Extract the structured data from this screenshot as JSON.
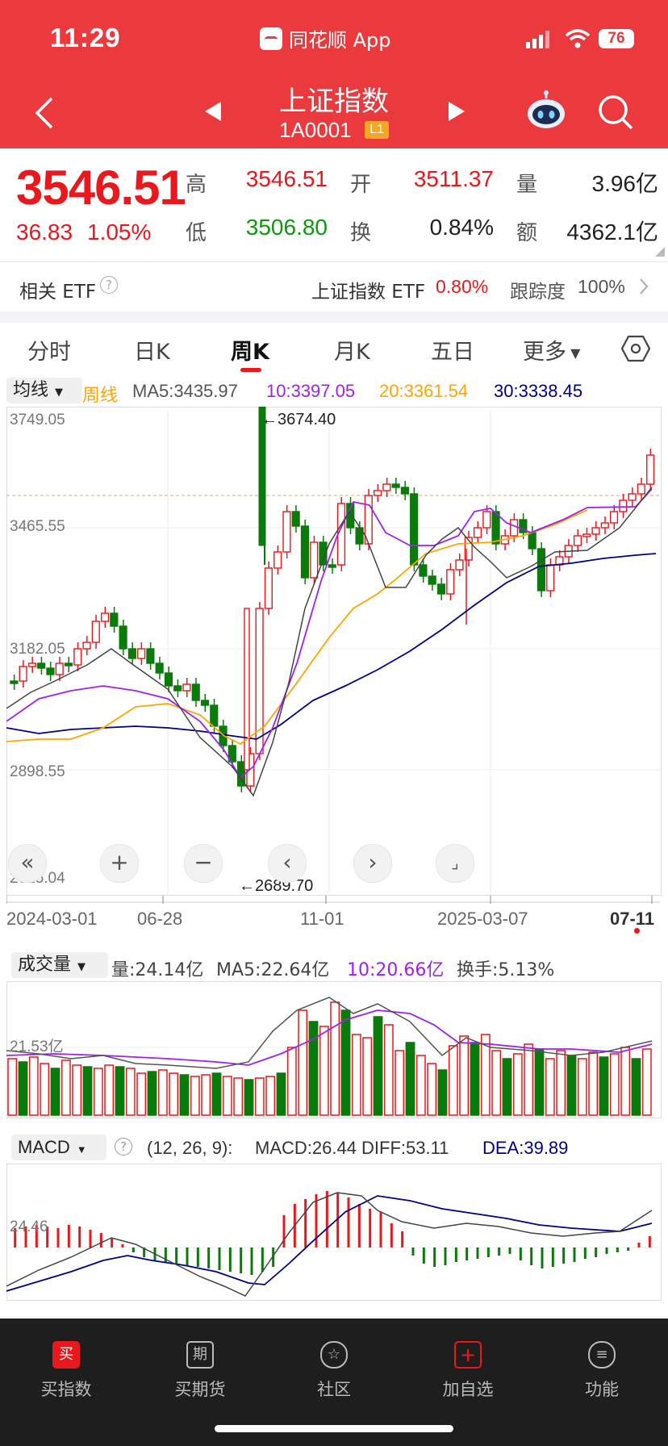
{
  "status_bar": {
    "time": "11:29",
    "app_name": "同花顺 App",
    "battery": "76"
  },
  "nav": {
    "title": "上证指数",
    "code": "1A0001",
    "badge": "L1"
  },
  "quote": {
    "price": "3546.51",
    "change": "36.83",
    "change_pct": "1.05%",
    "high_label": "高",
    "high": "3546.51",
    "low_label": "低",
    "low": "3506.80",
    "open_label": "开",
    "open": "3511.37",
    "turnover_label": "换",
    "turnover": "0.84%",
    "volume_label": "量",
    "volume": "3.96亿",
    "amount_label": "额",
    "amount": "4362.1亿"
  },
  "etf": {
    "label": "相关 ETF",
    "name": "上证指数 ETF",
    "change": "0.80%",
    "track_label": "跟踪度",
    "track": "100%"
  },
  "tabs": [
    {
      "label": "分时"
    },
    {
      "label": "日K"
    },
    {
      "label": "周K",
      "active": true
    },
    {
      "label": "月K"
    },
    {
      "label": "五日"
    },
    {
      "label": "更多"
    }
  ],
  "ma_bar": {
    "selector": "均线",
    "period": "周线",
    "ma5": "MA5:3435.97",
    "ma10": "10:3397.05",
    "ma20": "20:3361.54",
    "ma30": "30:3338.45"
  },
  "kline": {
    "y_labels": [
      "3749.05",
      "3465.55",
      "3182.05",
      "2898.55",
      "2615.04"
    ],
    "max_annot": "←3674.40",
    "min_annot": "←2689.70",
    "dates": [
      "2024-03-01",
      "06-28",
      "11-01",
      "2025-03-07",
      "07-11"
    ]
  },
  "volume": {
    "selector": "成交量",
    "vol": "量:24.14亿",
    "ma5": "MA5:22.64亿",
    "ma10": "10:20.66亿",
    "turnover": "换手:5.13%",
    "y_label": "21.53亿"
  },
  "macd": {
    "selector": "MACD",
    "params": "(12, 26, 9):",
    "macd": "MACD:26.44",
    "diff": "DIFF:53.11",
    "dea": "DEA:39.89",
    "y_label": "24.46"
  },
  "bottom_nav": [
    {
      "label": "买指数",
      "icon": "买"
    },
    {
      "label": "买期货",
      "icon": "期"
    },
    {
      "label": "社区",
      "icon": "☆"
    },
    {
      "label": "加自选",
      "icon": "+"
    },
    {
      "label": "功能",
      "icon": "≡"
    }
  ],
  "colors": {
    "up": "#e8181d",
    "down": "#0a7a0a",
    "header": "#eb3a3e",
    "ma5": "#555555",
    "ma10": "#a020f0",
    "ma20": "#ffa500",
    "ma30": "#00008b"
  }
}
